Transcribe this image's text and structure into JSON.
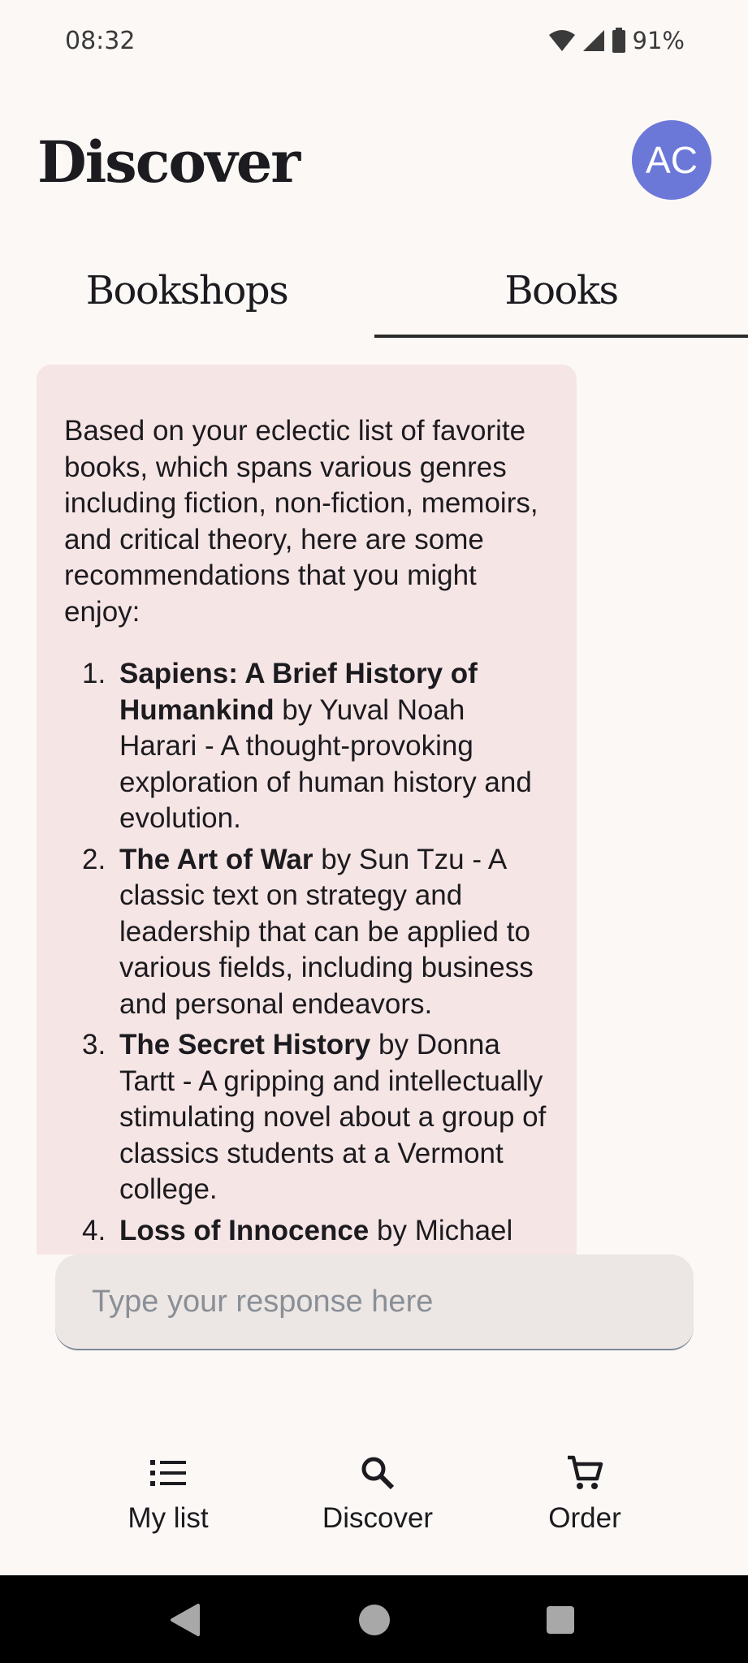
{
  "status_bar": {
    "time": "08:32",
    "battery": "91%"
  },
  "header": {
    "title": "Discover",
    "avatar_initials": "AC",
    "avatar_color": "#6c78d8"
  },
  "tabs": [
    {
      "label": "Bookshops",
      "selected": false
    },
    {
      "label": "Books",
      "selected": true
    }
  ],
  "message": {
    "intro": "Based on your eclectic list of favorite books, which spans various genres including fiction, non-fiction, memoirs, and critical theory, here are some recommendations that you might enjoy:",
    "recommendations": [
      {
        "num": "1.",
        "title": "Sapiens: A Brief History of Humankind",
        "rest": " by Yuval Noah Harari - A thought-provoking exploration of human history and evolution."
      },
      {
        "num": "2.",
        "title": "The Art of War",
        "rest": " by Sun Tzu - A classic text on strategy and leadership that can be applied to various fields, including business and personal endeavors."
      },
      {
        "num": "3.",
        "title": "The Secret History",
        "rest": " by Donna Tartt - A gripping and intellectually stimulating novel about a group of classics students at a Vermont college."
      },
      {
        "num": "4.",
        "title": "Loss of Innocence",
        "rest": " by Michael"
      }
    ]
  },
  "input": {
    "placeholder": "Type your response here"
  },
  "bottom_nav": [
    {
      "label": "My list",
      "icon": "list-icon"
    },
    {
      "label": "Discover",
      "icon": "search-icon"
    },
    {
      "label": "Order",
      "icon": "cart-icon"
    }
  ]
}
